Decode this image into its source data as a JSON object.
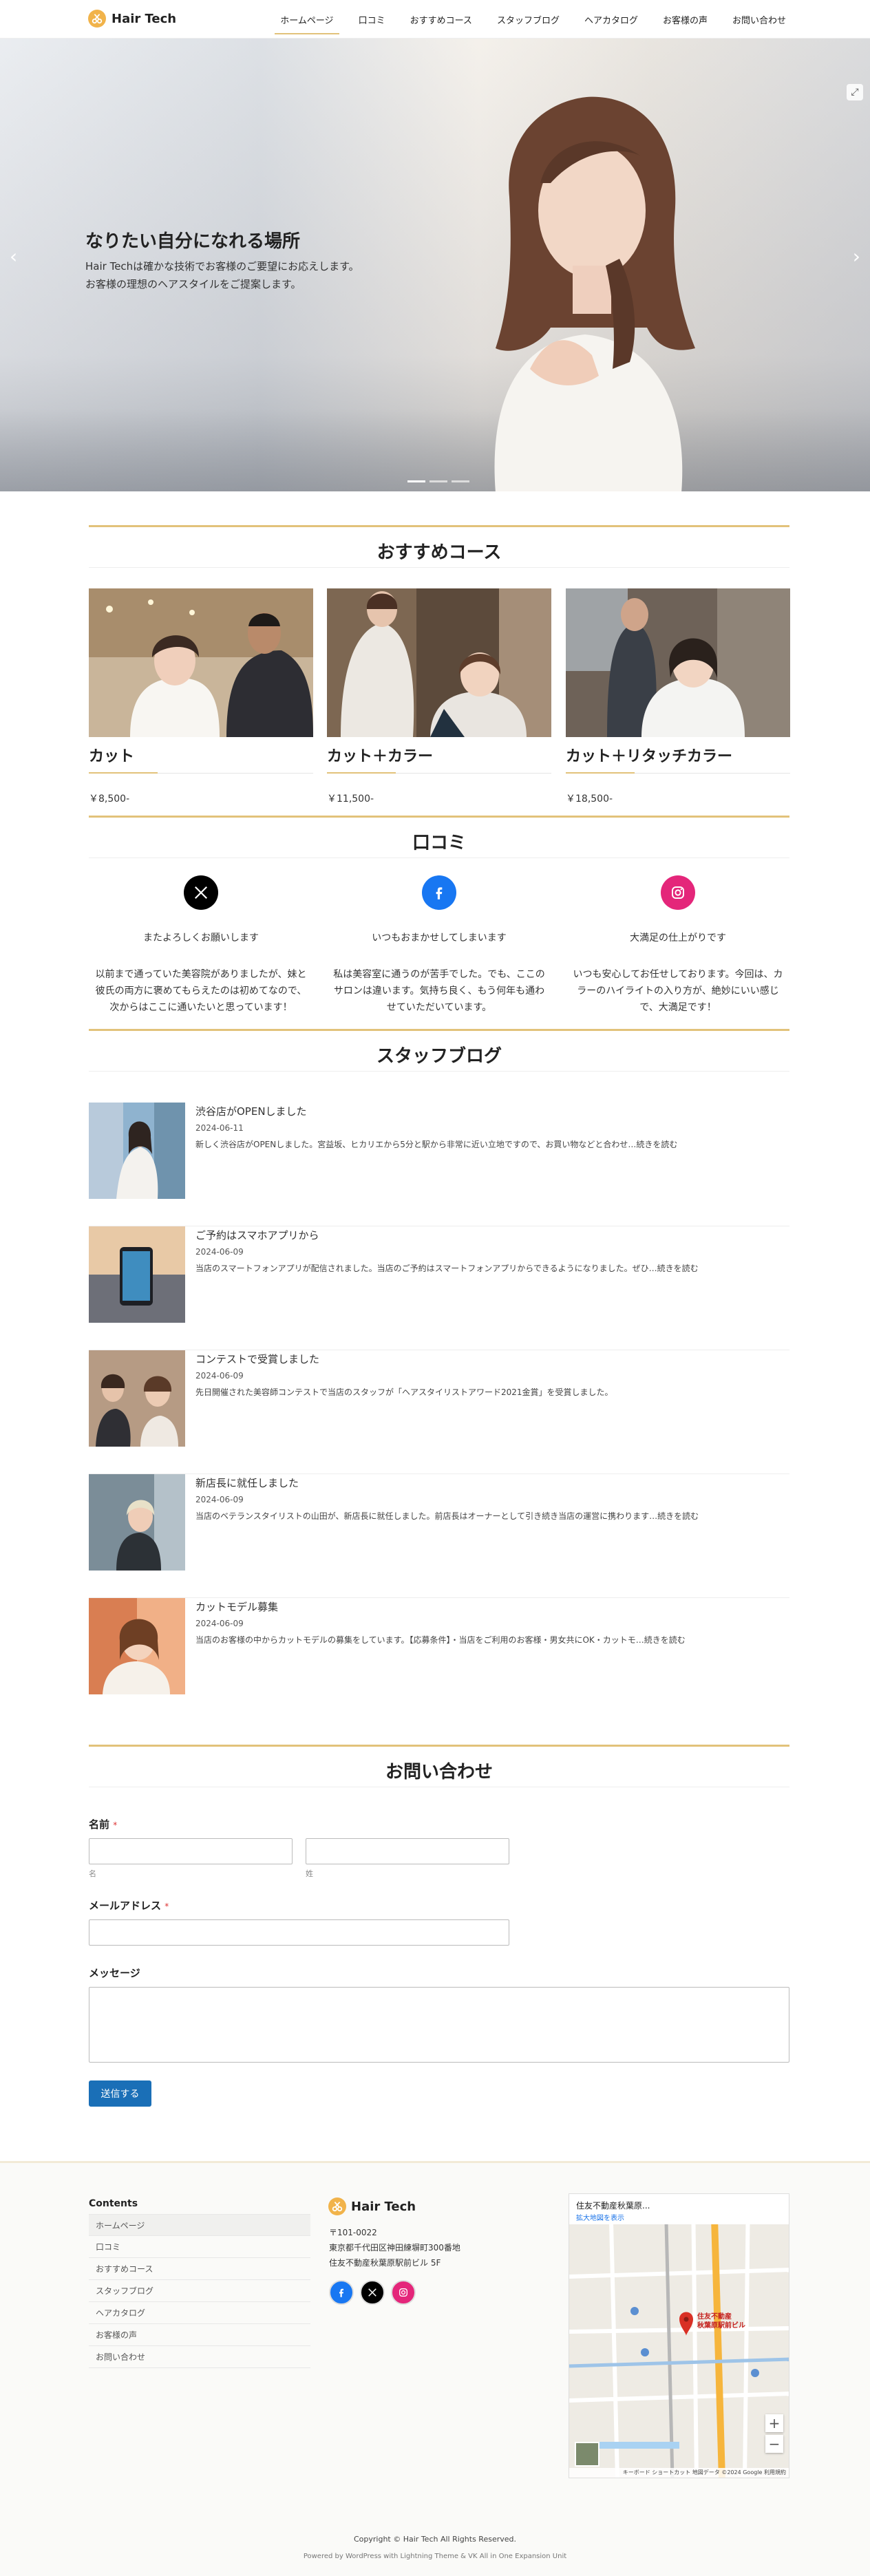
{
  "header": {
    "logo_text": "Hair Tech",
    "nav": [
      "ホームページ",
      "口コミ",
      "おすすめコース",
      "スタッフブログ",
      "ヘアカタログ",
      "お客様の声",
      "お問い合わせ"
    ]
  },
  "hero": {
    "title": "なりたい自分になれる場所",
    "line1": "Hair Techは確かな技術でお客様のご要望にお応えします。",
    "line2": "お客様の理想のヘアスタイルをご提案します。",
    "prev_arrow": "‹",
    "next_arrow": "›",
    "expand_icon": "⤢"
  },
  "courses": {
    "title": "おすすめコース",
    "items": [
      {
        "name": "カット",
        "price": "￥8,500-"
      },
      {
        "name": "カット＋カラー",
        "price": "￥11,500-"
      },
      {
        "name": "カット＋リタッチカラー",
        "price": "￥18,500-"
      }
    ]
  },
  "reviews": {
    "title": "口コミ",
    "items": [
      {
        "icon": "x-icon",
        "headline": "またよろしくお願いします",
        "line1": "以前まで通っていた美容院がありましたが、妹と",
        "line2": "彼氏の両方に褒めてもらえたのは初めてなので、",
        "line3": "次からはここに通いたいと思っています！"
      },
      {
        "icon": "facebook-icon",
        "headline": "いつもおまかせしてしまいます",
        "line1": "私は美容室に通うのが苦手でした。でも、ここの",
        "line2": "サロンは違います。気持ち良く、もう何年も通わ",
        "line3": "せていただいています。"
      },
      {
        "icon": "instagram-icon",
        "headline": "大満足の仕上がりです",
        "line1": "いつも安心してお任せしております。今回は、カ",
        "line2": "ラーのハイライトの入り方が、絶妙にいい感じ",
        "line3": "で、大満足です！"
      }
    ]
  },
  "blog": {
    "title": "スタッフブログ",
    "posts": [
      {
        "title": "渋谷店がOPENしました",
        "date": "2024-06-11",
        "excerpt": "新しく渋谷店がOPENしました。宮益坂、ヒカリエから5分と駅から非常に近い立地ですので、お買い物などと合わせ…続きを読む"
      },
      {
        "title": "ご予約はスマホアプリから",
        "date": "2024-06-09",
        "excerpt": "当店のスマートフォンアプリが配信されました。当店のご予約はスマートフォンアプリからできるようになりました。ぜひ…続きを読む"
      },
      {
        "title": "コンテストで受賞しました",
        "date": "2024-06-09",
        "excerpt": "先日開催された美容師コンテストで当店のスタッフが「ヘアスタイリストアワード2021金賞」を受賞しました。"
      },
      {
        "title": "新店長に就任しました",
        "date": "2024-06-09",
        "excerpt": "当店のベテランスタイリストの山田が、新店長に就任しました。前店長はオーナーとして引き続き当店の運営に携わります…続きを読む"
      },
      {
        "title": "カットモデル募集",
        "date": "2024-06-09",
        "excerpt": "当店のお客様の中からカットモデルの募集をしています。【応募条件】・当店をご利用のお客様・男女共にOK・カットモ…続きを読む"
      }
    ]
  },
  "contact": {
    "title": "お問い合わせ",
    "name_label": "名前",
    "required_mark": "*",
    "first_hint": "名",
    "last_hint": "姓",
    "email_label": "メールアドレス",
    "message_label": "メッセージ",
    "submit_label": "送信する"
  },
  "footer": {
    "menu_heading": "Contents",
    "menu": [
      "ホームページ",
      "口コミ",
      "おすすめコース",
      "スタッフブログ",
      "ヘアカタログ",
      "お客様の声",
      "お問い合わせ"
    ],
    "logo_text": "Hair Tech",
    "postal": "〒101-0022",
    "address1": "東京都千代田区神田練塀町300番地",
    "address2": "住友不動産秋葉原駅前ビル 5F",
    "social": [
      "facebook-icon",
      "x-icon",
      "instagram-icon"
    ],
    "map_title": "住友不動産秋葉原...",
    "map_link": "拡大地図を表示",
    "map_pin_label1": "住友不動産",
    "map_pin_label2": "秋葉原駅前ビル",
    "map_zoom_in": "+",
    "map_zoom_out": "−",
    "map_footer": "キーボード ショートカット  地図データ ©2024 Google  利用規約",
    "copyright": "Copyright © Hair Tech All Rights Reserved.",
    "powered": "Powered by WordPress with Lightning Theme & VK All in One Expansion Unit"
  },
  "colors": {
    "accent": "#e2c27a",
    "button": "#1a6fb7",
    "facebook": "#1877f2",
    "instagram": "#e4267a",
    "x": "#000000"
  }
}
